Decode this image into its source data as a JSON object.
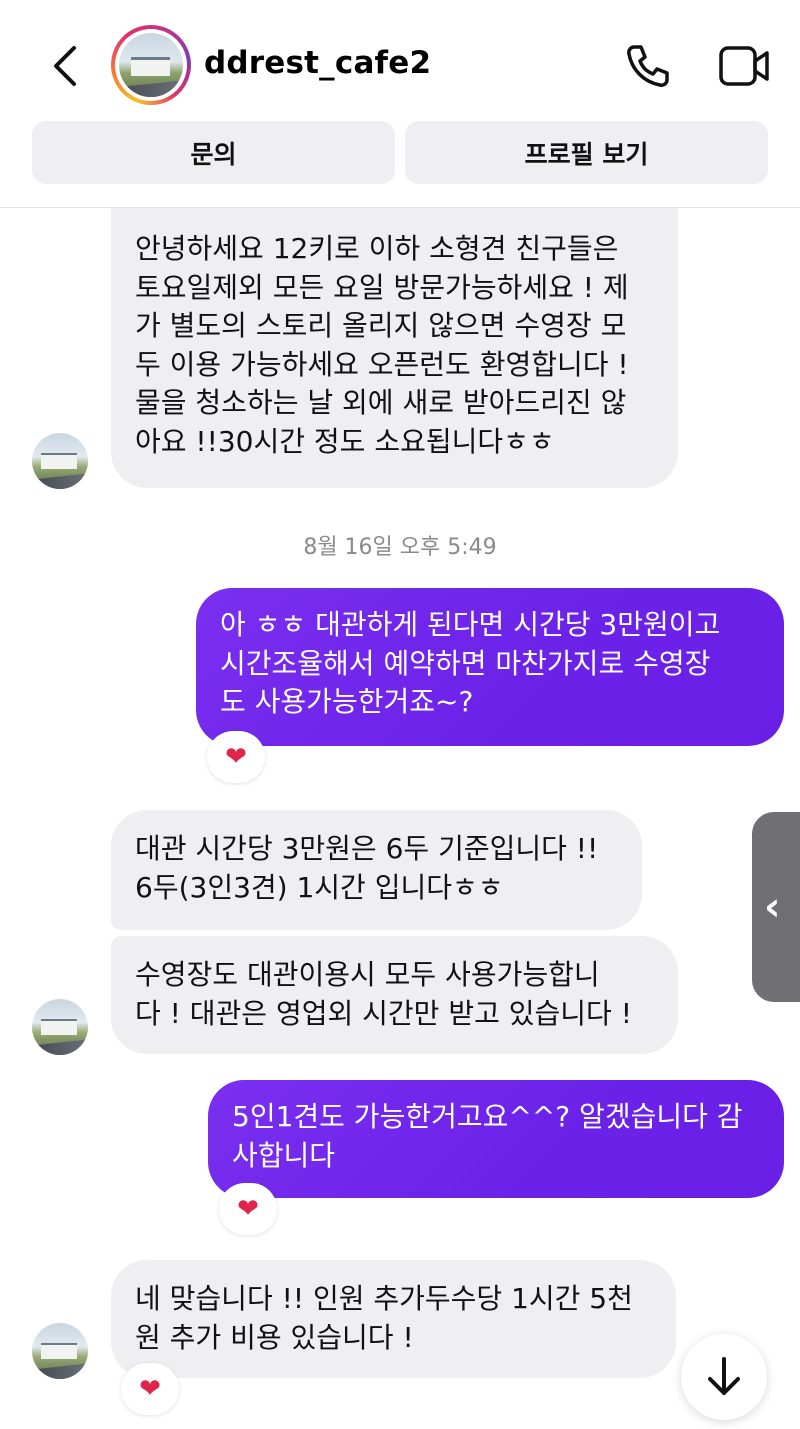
{
  "header": {
    "username": "ddrest_cafe2",
    "icons": {
      "back": "chevron-left-icon",
      "call": "phone-icon",
      "video": "video-camera-icon"
    }
  },
  "actions": {
    "inquiry_label": "문의",
    "profile_label": "프로필 보기"
  },
  "messages": [
    {
      "direction": "in",
      "lines": [
        "안녕하세요 12키로 이하 소형견 친구들은",
        "토요일제외 모든 요일 방문가능하세요 ! 제",
        "가 별도의 스토리 올리지 않으면 수영장 모",
        "두 이용 가능하세요 오픈런도 환영합니다 !",
        "물을 청소하는 날 외에 새로 받아드리진 않",
        "아요 !!30시간 정도 소요됩니다ㅎㅎ"
      ]
    },
    {
      "timestamp": "8월 16일 오후 5:49"
    },
    {
      "direction": "out",
      "lines": [
        "아 ㅎㅎ 대관하게 된다면 시간당 3만원이고",
        "시간조율해서 예약하면 마찬가지로 수영장",
        "도 사용가능한거죠~?"
      ],
      "reaction": "❤"
    },
    {
      "direction": "in",
      "lines": [
        "대관 시간당 3만원은 6두 기준입니다 !!",
        "6두(3인3견) 1시간 입니다ㅎㅎ"
      ]
    },
    {
      "direction": "in",
      "lines": [
        "수영장도 대관이용시 모두 사용가능합니",
        "다 ! 대관은 영업외 시간만 받고 있습니다 !"
      ]
    },
    {
      "direction": "out",
      "lines": [
        "5인1견도 가능한거고요^^? 알겠습니다 감",
        "사합니다"
      ],
      "reaction": "❤"
    },
    {
      "direction": "in",
      "lines": [
        "네 맞습니다 !! 인원 추가두수당 1시간 5천",
        "원 추가 비용 있습니다 !"
      ],
      "reaction": "❤"
    }
  ],
  "colors": {
    "outgoing_bubble": "#6b22e8",
    "incoming_bubble": "#efeff2",
    "heart": "#e0244a"
  }
}
